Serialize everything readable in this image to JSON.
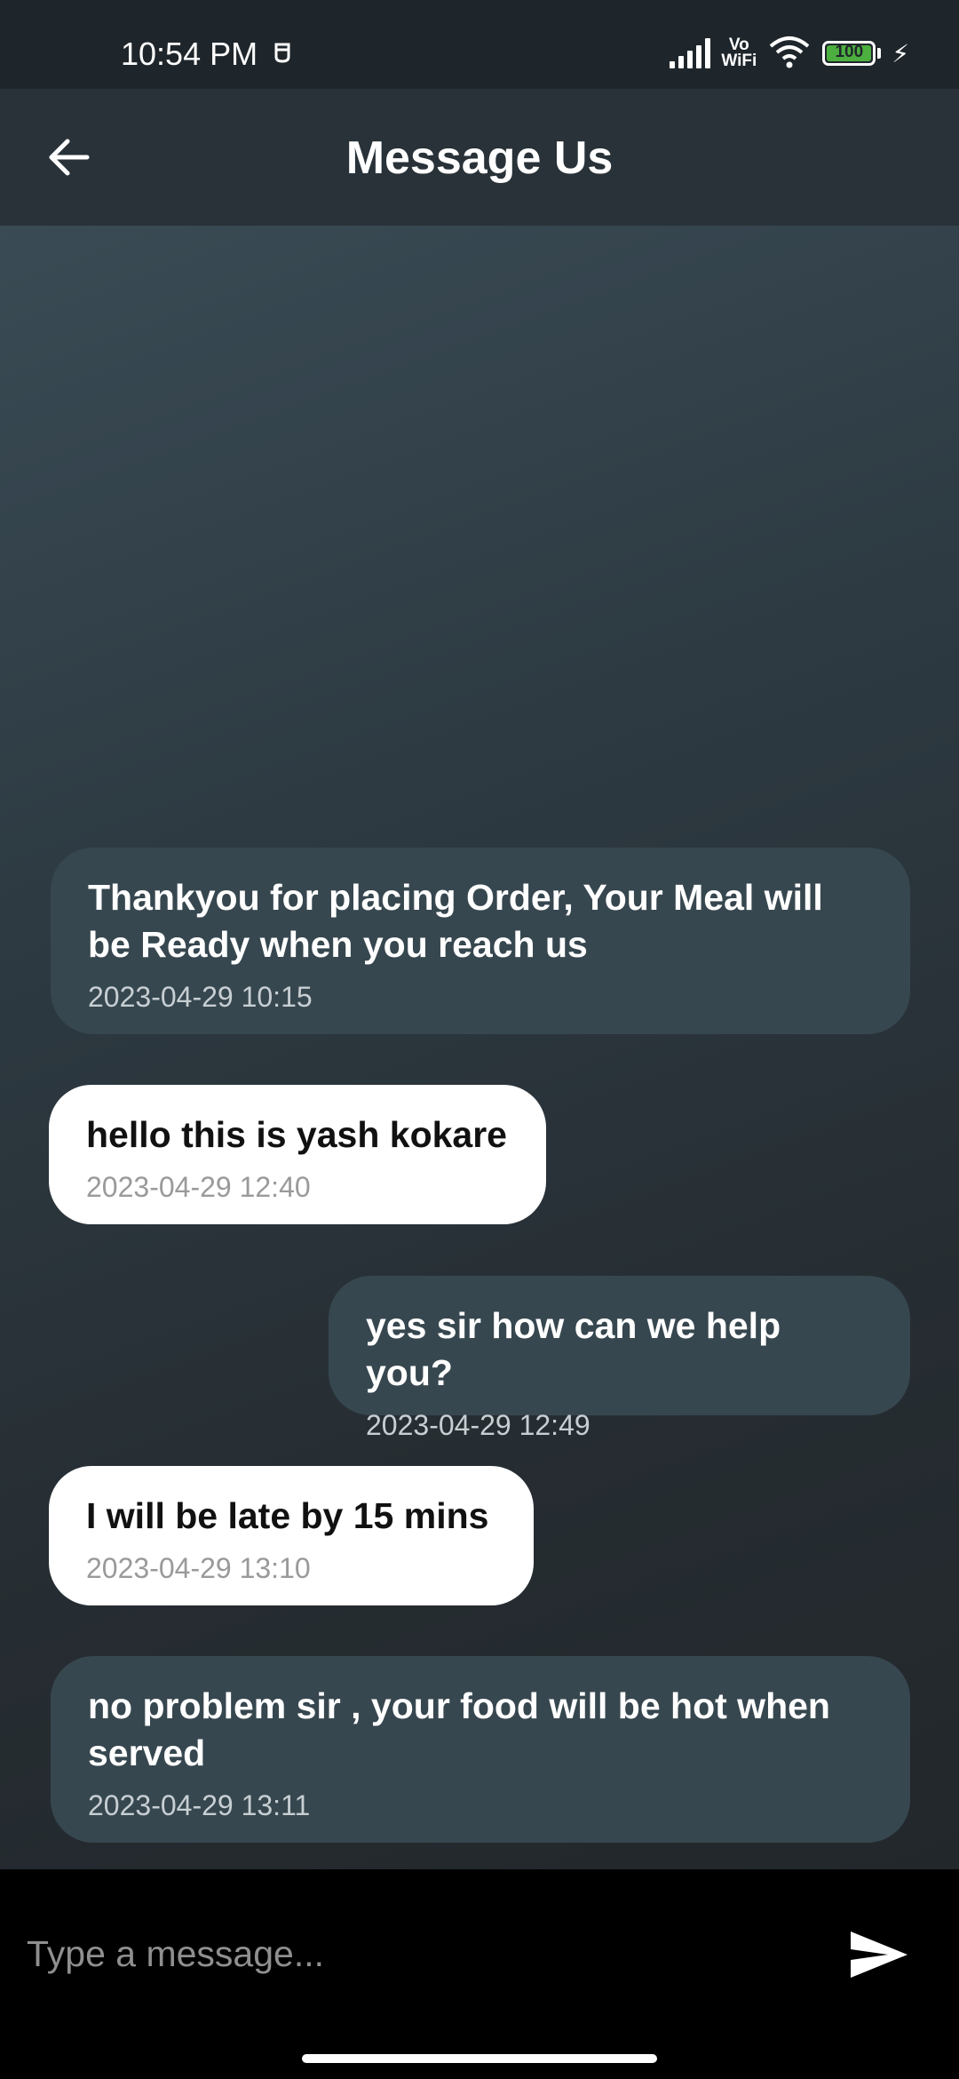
{
  "status_bar": {
    "time": "10:54 PM",
    "network_label": "Vo\nWiFi",
    "battery_level": "100"
  },
  "header": {
    "title": "Message Us"
  },
  "messages": [
    {
      "sender": "restaurant",
      "text": "Thankyou for placing Order, Your Meal will be Ready when you reach us",
      "time": "2023-04-29 10:15"
    },
    {
      "sender": "user",
      "text": "hello this is yash kokare",
      "time": "2023-04-29 12:40"
    },
    {
      "sender": "restaurant",
      "text": "yes sir how can we help you?",
      "time": "2023-04-29 12:49"
    },
    {
      "sender": "user",
      "text": "I will be late by 15 mins",
      "time": "2023-04-29 13:10"
    },
    {
      "sender": "restaurant",
      "text": "no problem sir , your food will be hot when served",
      "time": "2023-04-29 13:11"
    }
  ],
  "composer": {
    "placeholder": "Type a message..."
  },
  "colors": {
    "app_bar": "#283238",
    "bot_bubble": "#37474f",
    "user_bubble": "#ffffff",
    "input_bar": "#000000"
  }
}
